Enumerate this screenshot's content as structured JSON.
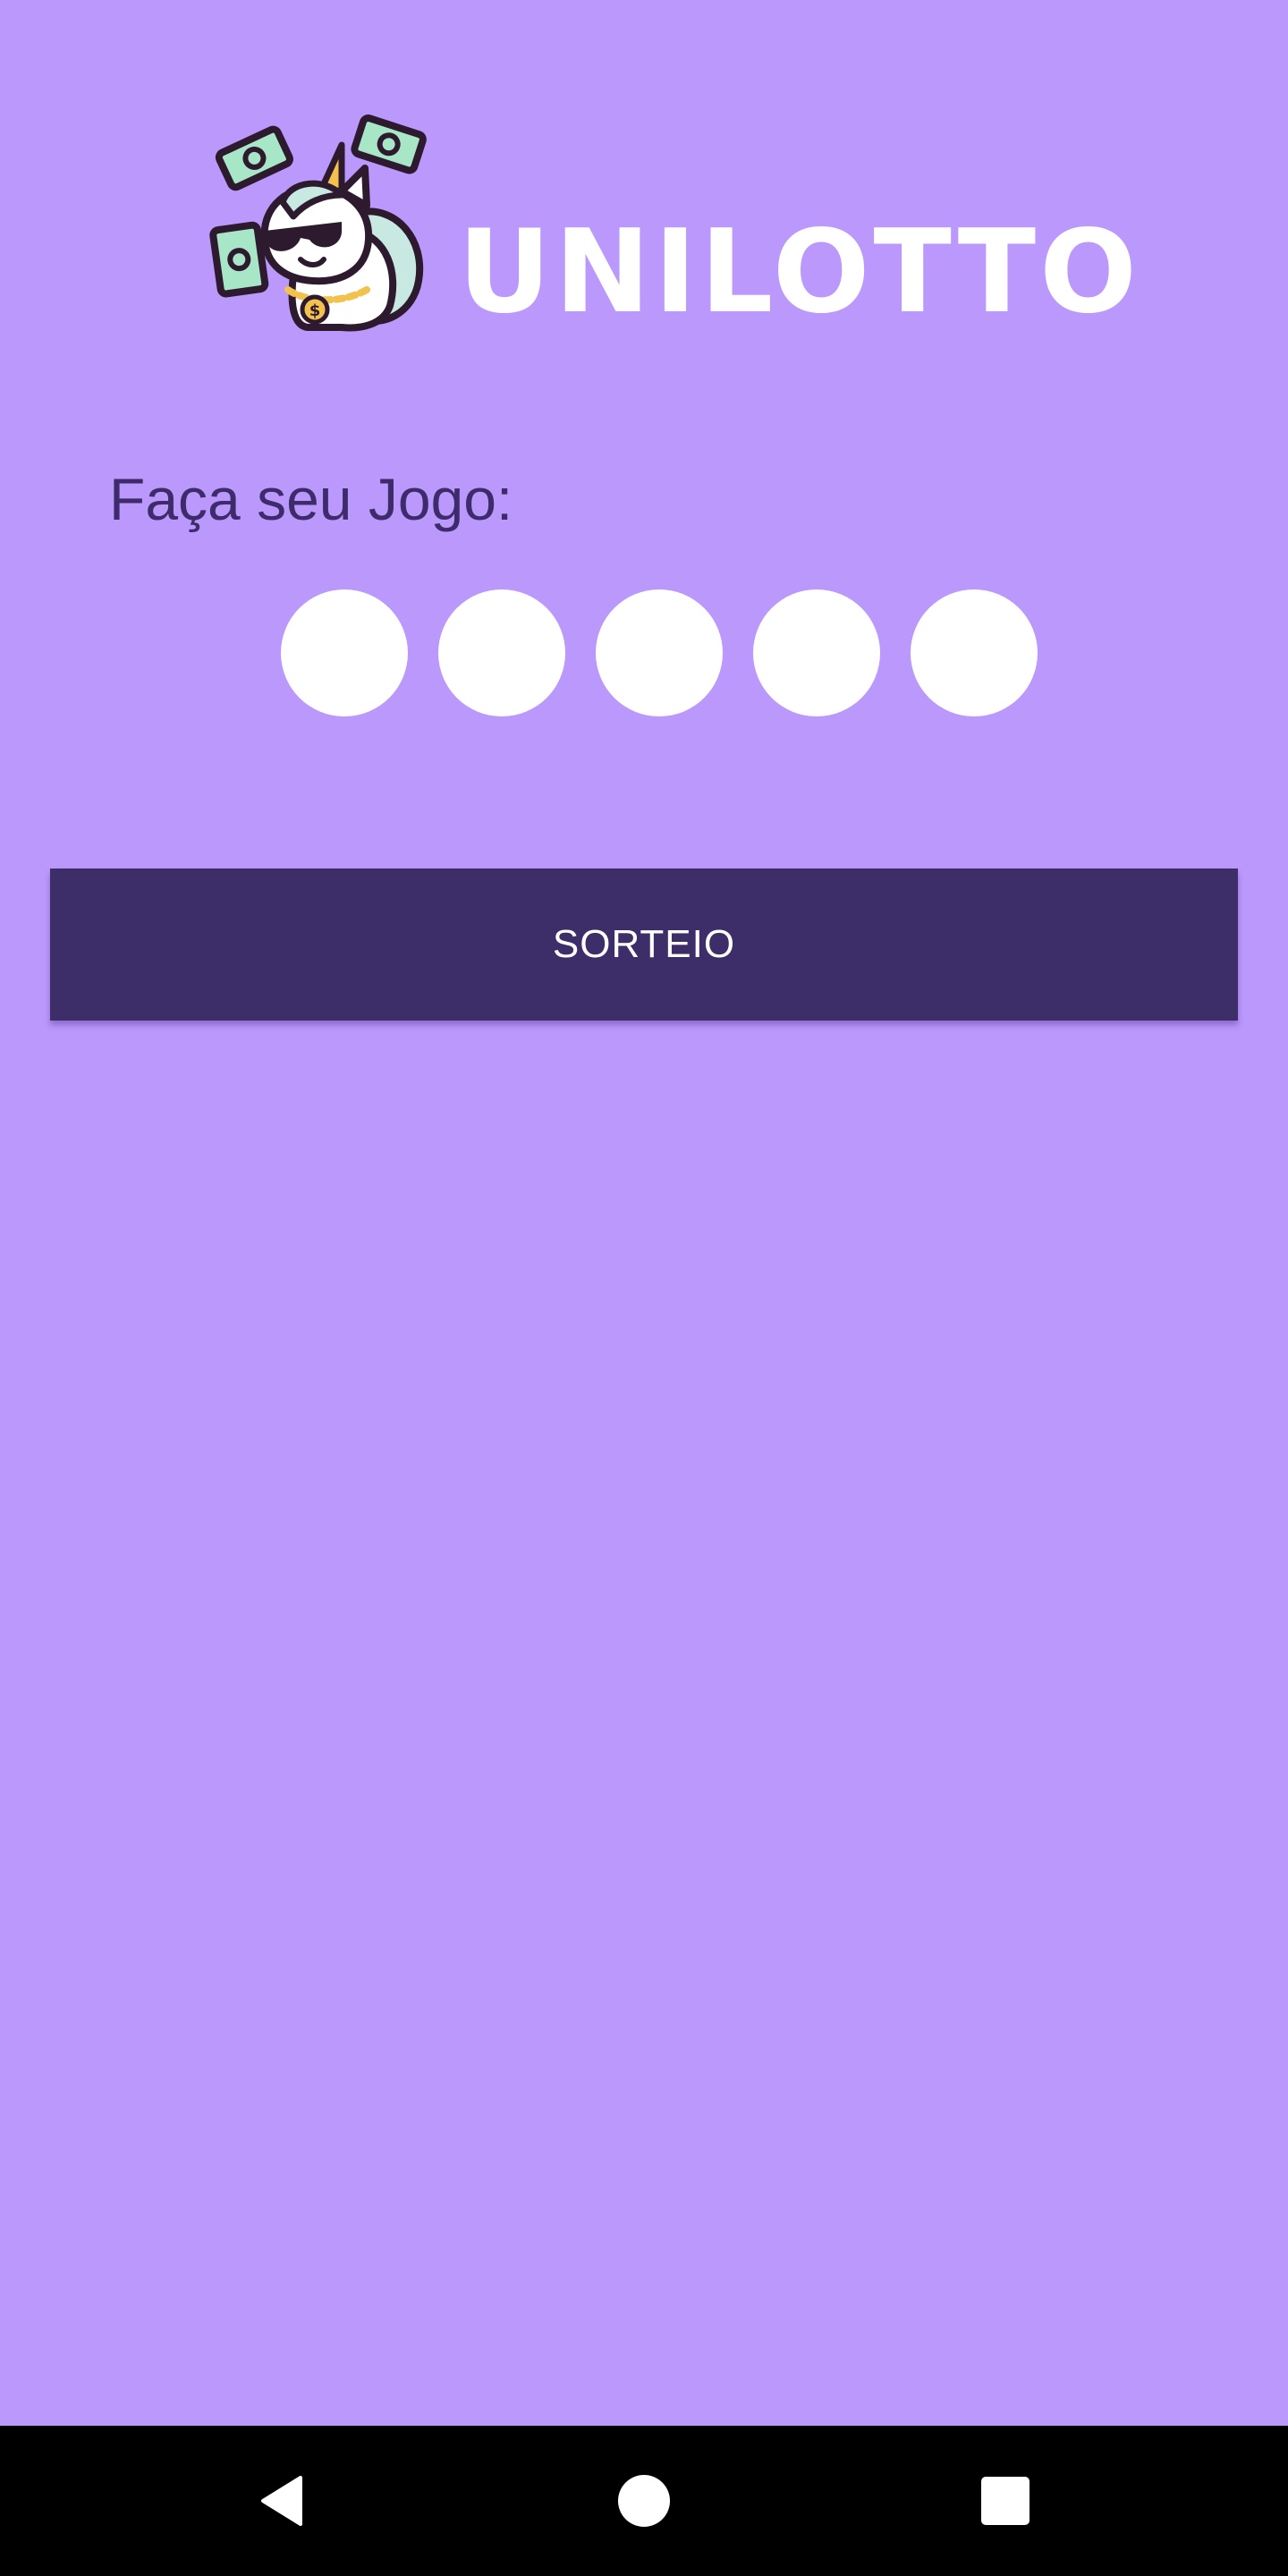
{
  "app": {
    "name": "UNILOTTO"
  },
  "prompt": {
    "label": "Faça seu Jogo:"
  },
  "numbers": [
    "",
    "",
    "",
    "",
    ""
  ],
  "actions": {
    "draw_label": "SORTEIO"
  },
  "colors": {
    "background": "#BA98FC",
    "prompt_text": "#3D2B6B",
    "button": "#3D2D68",
    "ball": "#FFFFFF",
    "money": "#A8E6C8",
    "outline": "#2E1A2E",
    "gold": "#F2C14E"
  },
  "icons": {
    "logo": "unicorn-mascot-icon",
    "nav_back": "back-triangle-icon",
    "nav_home": "home-circle-icon",
    "nav_recents": "recents-square-icon"
  }
}
